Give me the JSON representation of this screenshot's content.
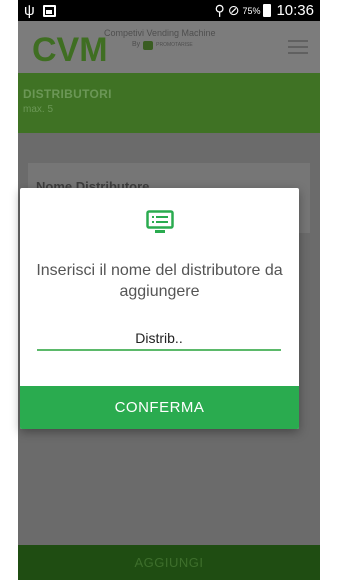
{
  "status_bar": {
    "icons": [
      "usb-icon",
      "image-icon",
      "wifi-icon",
      "no-sim-icon",
      "battery-icon"
    ],
    "battery_percent": "75%",
    "time": "10:36"
  },
  "app_header": {
    "logo_text": "CVM",
    "tagline": "Competivi Vending Machine",
    "by_text": "By",
    "brand_text": "PROMOTARISE",
    "menu_icon": "hamburger-menu-icon"
  },
  "section": {
    "title": "DISTRIBUTORI",
    "subtitle": "max. 5"
  },
  "card": {
    "label": "Nome Distributore"
  },
  "dialog": {
    "icon": "distributor-screen-icon",
    "message": "Inserisci il nome del distributore da aggiungere",
    "input_value": "",
    "input_placeholder": "Distrib..",
    "confirm_label": "CONFERMA"
  },
  "bottom_bar": {
    "add_label": "AGGIUNGI"
  },
  "colors": {
    "accent_green": "#2aab4f",
    "input_underline": "#5bb96a",
    "section_green": "#3f7224",
    "bottom_bar": "#1f4d12",
    "overlay": "#6b6b6b"
  }
}
